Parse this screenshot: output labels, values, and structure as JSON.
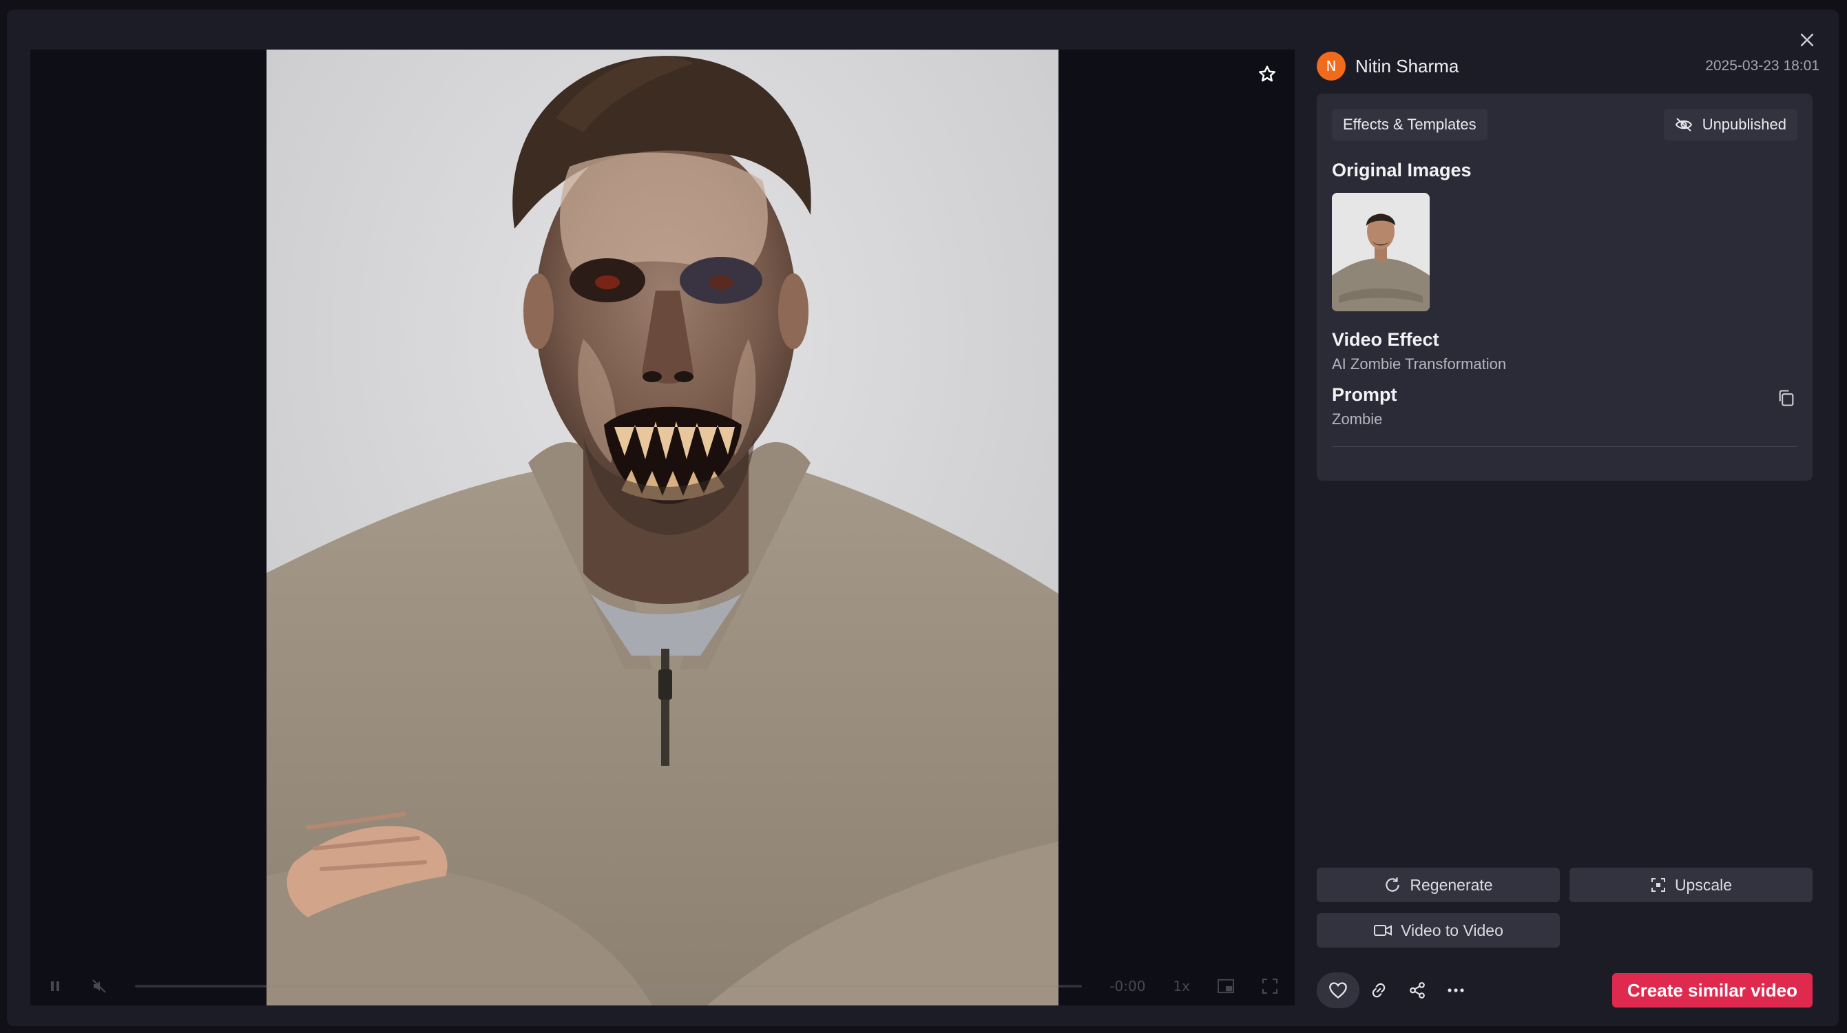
{
  "user": {
    "avatar_letter": "N",
    "name": "Nitin Sharma",
    "timestamp": "2025-03-23 18:01"
  },
  "card": {
    "category_chip": "Effects & Templates",
    "status_chip": "Unpublished",
    "original_images_title": "Original Images",
    "video_effect_title": "Video Effect",
    "video_effect_value": "AI Zombie Transformation",
    "prompt_title": "Prompt",
    "prompt_value": "Zombie"
  },
  "actions": {
    "regenerate": "Regenerate",
    "upscale": "Upscale",
    "video_to_video": "Video to Video",
    "create_similar": "Create similar video"
  },
  "player": {
    "speed": "1x",
    "time": "-0:00",
    "progress": 0
  },
  "colors": {
    "accent": "#e0294f",
    "avatar": "#f26a1b",
    "panel": "#1c1c27",
    "card": "#2b2b37"
  },
  "icons": [
    "close-icon",
    "star-icon",
    "pause-icon",
    "mute-icon",
    "pip-icon",
    "fullscreen-icon",
    "eye-off-icon",
    "copy-icon",
    "refresh-icon",
    "upscale-icon",
    "video-icon",
    "heart-icon",
    "link-icon",
    "share-icon",
    "more-icon"
  ]
}
